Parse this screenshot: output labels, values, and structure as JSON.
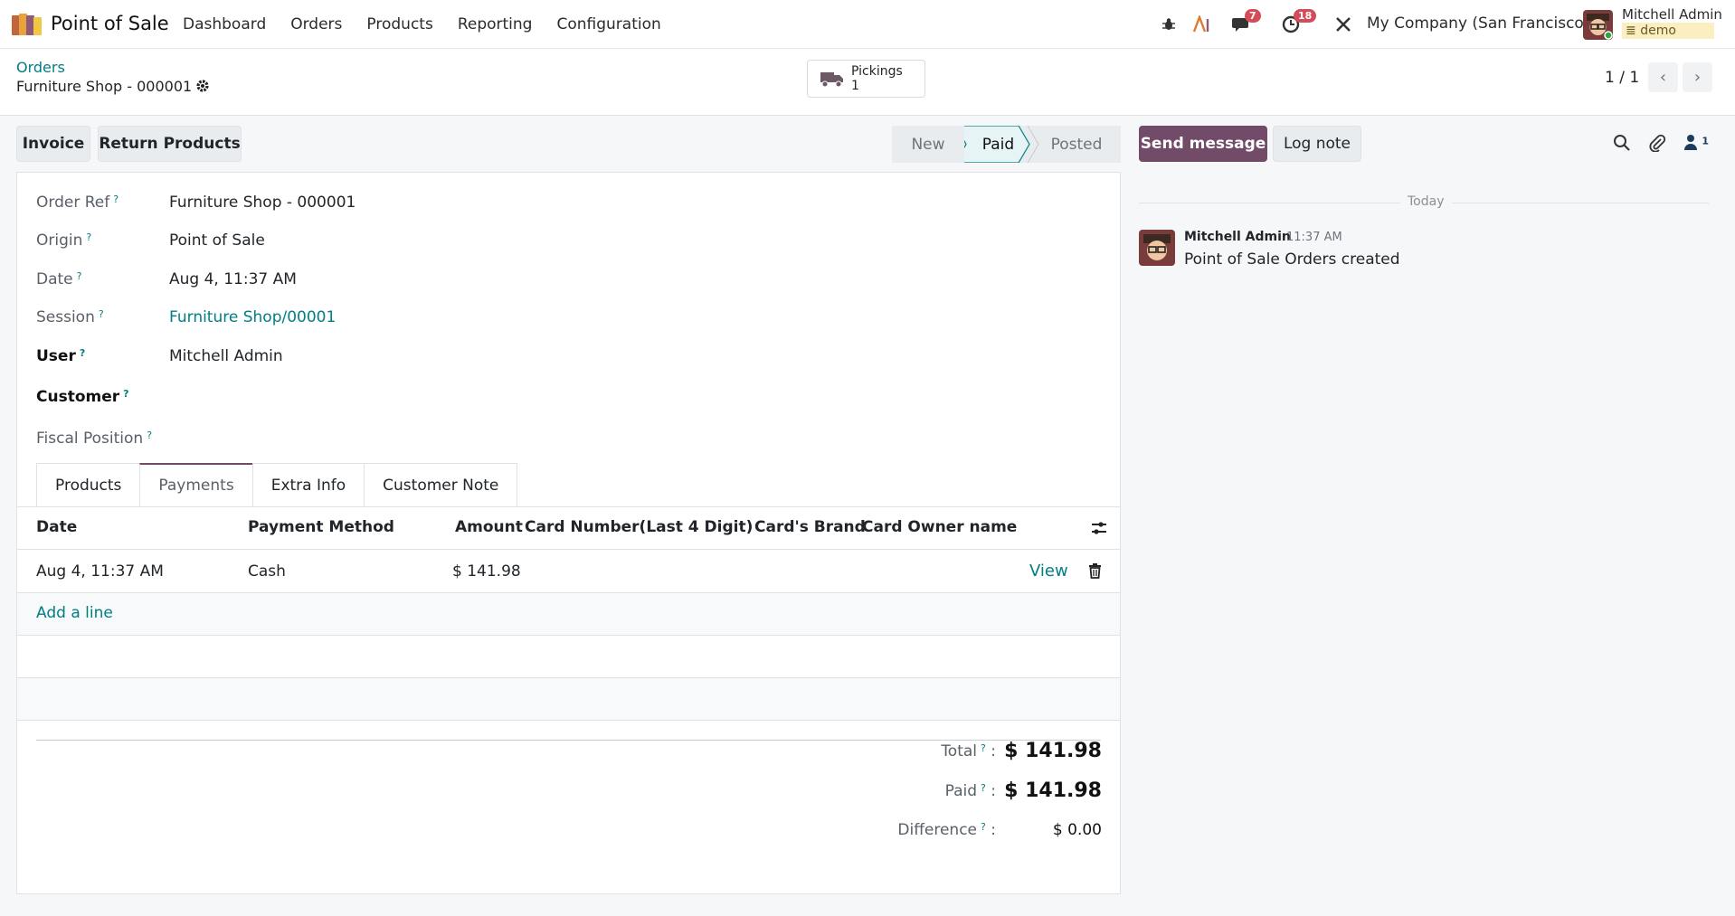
{
  "app": {
    "name": "Point of Sale",
    "menu": [
      "Dashboard",
      "Orders",
      "Products",
      "Reporting",
      "Configuration"
    ]
  },
  "systray": {
    "messages_count": "7",
    "activities_count": "18",
    "company": "My Company (San Francisco)",
    "user_name": "Mitchell Admin",
    "database": "demo"
  },
  "breadcrumb": {
    "parent": "Orders",
    "current": "Furniture Shop - 000001"
  },
  "smart_button": {
    "label": "Pickings",
    "count": "1"
  },
  "pager": {
    "value": "1 / 1"
  },
  "actions": {
    "invoice": "Invoice",
    "return_products": "Return Products"
  },
  "statusbar": {
    "stages": [
      "New",
      "Paid",
      "Posted"
    ],
    "current": "Paid"
  },
  "fields": {
    "order_ref_label": "Order Ref",
    "order_ref": "Furniture Shop - 000001",
    "origin_label": "Origin",
    "origin": "Point of Sale",
    "date_label": "Date",
    "date": "Aug 4, 11:37 AM",
    "session_label": "Session",
    "session": "Furniture Shop/00001",
    "user_label": "User",
    "user": "Mitchell Admin",
    "customer_label": "Customer",
    "fiscal_position_label": "Fiscal Position",
    "help_mark": "?"
  },
  "tabs": [
    "Products",
    "Payments",
    "Extra Info",
    "Customer Note"
  ],
  "active_tab": "Payments",
  "payments_table": {
    "columns": [
      "Date",
      "Payment Method",
      "Amount",
      "Card Number(Last 4 Digit)",
      "Card's Brand",
      "Card Owner name"
    ],
    "rows": [
      {
        "date": "Aug 4, 11:37 AM",
        "method": "Cash",
        "amount": "$ 141.98",
        "action": "View"
      }
    ],
    "add_line": "Add a line"
  },
  "totals": {
    "total_label": "Total",
    "total": "$ 141.98",
    "paid_label": "Paid",
    "paid": "$ 141.98",
    "difference_label": "Difference",
    "difference": "$ 0.00",
    "colon": ":"
  },
  "chatter": {
    "send_message": "Send message",
    "log_note": "Log note",
    "followers_count": "1",
    "date_separator": "Today",
    "messages": [
      {
        "author": "Mitchell Admin",
        "time": "11:37 AM",
        "body": "Point of Sale Orders created"
      }
    ]
  },
  "colors": {
    "primary": "#714b67",
    "link": "#017e84",
    "badge": "#d44c59"
  }
}
